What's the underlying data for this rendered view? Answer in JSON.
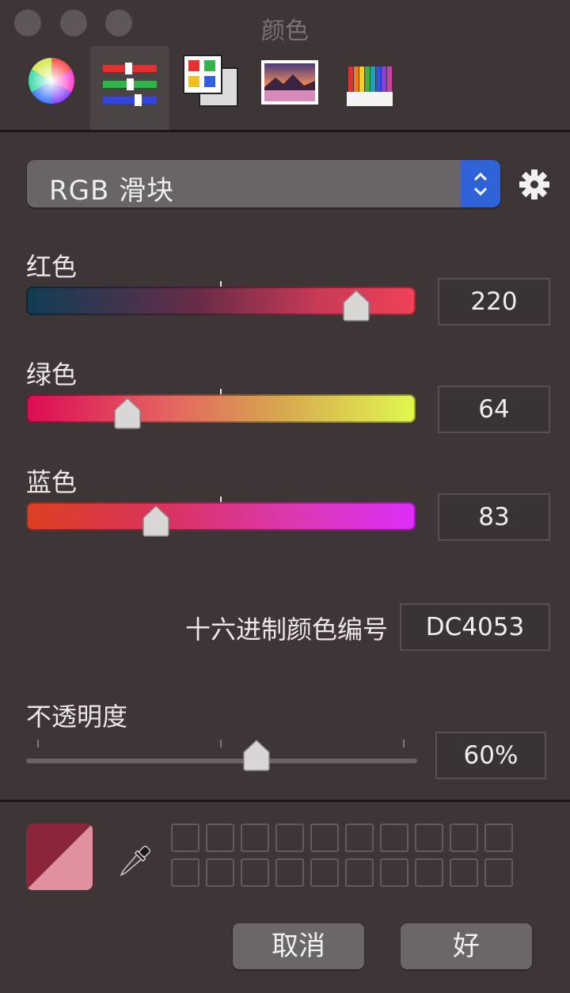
{
  "window": {
    "title": "颜色"
  },
  "toolbar": {
    "tools": [
      {
        "name": "color-wheel",
        "icon": "color-wheel-icon"
      },
      {
        "name": "color-sliders",
        "icon": "sliders-icon",
        "selected": true
      },
      {
        "name": "color-palettes",
        "icon": "palettes-icon"
      },
      {
        "name": "image-palettes",
        "icon": "image-palettes-icon"
      },
      {
        "name": "pencils",
        "icon": "pencils-icon"
      }
    ]
  },
  "mode_popup": {
    "label": "RGB 滑块"
  },
  "sliders": [
    {
      "label": "红色",
      "value": "220",
      "fraction": 0.8627
    },
    {
      "label": "绿色",
      "value": "64",
      "fraction": 0.251
    },
    {
      "label": "蓝色",
      "value": "83",
      "fraction": 0.3255
    }
  ],
  "hex": {
    "label": "十六进制颜色编号",
    "value": "DC4053"
  },
  "opacity": {
    "label": "不透明度",
    "value": "60%",
    "fraction": 0.6
  },
  "current_color": {
    "solid": "#8a2638",
    "translucent": "#e0909e"
  },
  "buttons": {
    "cancel": "取消",
    "ok": "好"
  },
  "colors": {
    "accent": "#2e62d6",
    "background": "#3d3536"
  }
}
